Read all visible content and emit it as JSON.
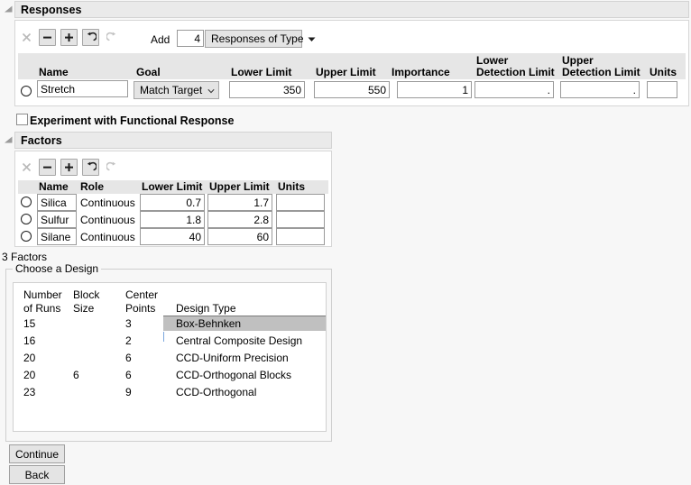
{
  "responses": {
    "panel_title": "Responses",
    "toolbar": [
      {
        "name": "remove-all-icon",
        "glyph": "x",
        "enabled": false
      },
      {
        "name": "remove-icon",
        "glyph": "minus",
        "enabled": true
      },
      {
        "name": "add-icon",
        "glyph": "plus",
        "enabled": true
      },
      {
        "name": "undo-icon",
        "glyph": "undo",
        "enabled": true
      },
      {
        "name": "redo-icon",
        "glyph": "redo",
        "enabled": false
      }
    ],
    "add_label": "Add",
    "add_count": "4",
    "add_type_label": "Responses of Type",
    "columns": [
      "Name",
      "Goal",
      "Lower Limit",
      "Upper Limit",
      "Importance",
      "Lower\nDetection Limit",
      "Upper\nDetection Limit",
      "Units"
    ],
    "column_labels": {
      "name": "Name",
      "goal": "Goal",
      "lower_limit": "Lower Limit",
      "upper_limit": "Upper Limit",
      "importance": "Importance",
      "lower_detection_limit_1": "Lower",
      "lower_detection_limit_2": "Detection Limit",
      "upper_detection_limit_1": "Upper",
      "upper_detection_limit_2": "Detection Limit",
      "units": "Units"
    },
    "rows": [
      {
        "name": "Stretch",
        "goal": "Match Target",
        "lower_limit": "350",
        "upper_limit": "550",
        "importance": "1",
        "lower_detection_limit": ".",
        "upper_detection_limit": ".",
        "units": ""
      }
    ],
    "functional_response_label": "Experiment with Functional Response",
    "functional_response_checked": false
  },
  "factors": {
    "panel_title": "Factors",
    "toolbar": [
      {
        "name": "remove-all-icon",
        "glyph": "x",
        "enabled": false
      },
      {
        "name": "remove-icon",
        "glyph": "minus",
        "enabled": true
      },
      {
        "name": "add-icon",
        "glyph": "plus",
        "enabled": true
      },
      {
        "name": "undo-icon",
        "glyph": "undo",
        "enabled": true
      },
      {
        "name": "redo-icon",
        "glyph": "redo",
        "enabled": false
      }
    ],
    "column_labels": {
      "name": "Name",
      "role": "Role",
      "lower_limit": "Lower Limit",
      "upper_limit": "Upper Limit",
      "units": "Units"
    },
    "rows": [
      {
        "name": "Silica",
        "role": "Continuous",
        "lower_limit": "0.7",
        "upper_limit": "1.7",
        "units": ""
      },
      {
        "name": "Sulfur",
        "role": "Continuous",
        "lower_limit": "1.8",
        "upper_limit": "2.8",
        "units": ""
      },
      {
        "name": "Silane",
        "role": "Continuous",
        "lower_limit": "40",
        "upper_limit": "60",
        "units": ""
      }
    ],
    "summary": "3 Factors"
  },
  "choose_design": {
    "group_title": "Choose a Design",
    "headers": {
      "runs_1": "Number",
      "runs_2": "of Runs",
      "block_1": "Block",
      "block_2": "Size",
      "center_1": "Center",
      "center_2": "Points",
      "type": "Design Type"
    },
    "rows": [
      {
        "runs": "15",
        "block": "",
        "center": "3",
        "type": "Box-Behnken",
        "selected": true
      },
      {
        "runs": "16",
        "block": "",
        "center": "2",
        "type": "Central Composite Design",
        "selected": false
      },
      {
        "runs": "20",
        "block": "",
        "center": "6",
        "type": "CCD-Uniform Precision",
        "selected": false
      },
      {
        "runs": "20",
        "block": "6",
        "center": "6",
        "type": "CCD-Orthogonal Blocks",
        "selected": false
      },
      {
        "runs": "23",
        "block": "",
        "center": "9",
        "type": "CCD-Orthogonal",
        "selected": false
      }
    ]
  },
  "footer": {
    "continue_label": "Continue",
    "back_label": "Back"
  },
  "colors": {
    "background": "#f7f7f7",
    "panel_header": "#eaeaea",
    "table_header": "#e6e6e6",
    "selection": "#c0c0c0",
    "button_face": "#e4e4e4"
  }
}
